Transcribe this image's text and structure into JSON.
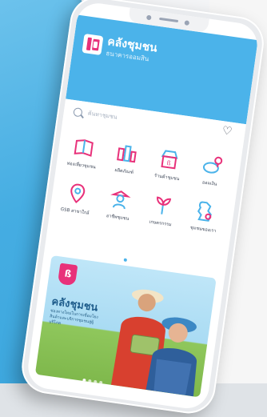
{
  "app": {
    "name": "คลังชุมชน",
    "subtitle": "ธนาคารออมสิน"
  },
  "search": {
    "placeholder": "ค้นหาชุมชน"
  },
  "icons": [
    {
      "name": "book-icon",
      "label": "ท่องเที่ยวชุมชน"
    },
    {
      "name": "products-icon",
      "label": "ผลิตภัณฑ์"
    },
    {
      "name": "shop-icon",
      "label": "ร้านค้าชุมชน"
    },
    {
      "name": "piggy-bank-icon",
      "label": "ออมเงิน"
    },
    {
      "name": "location-pin-icon",
      "label": "GSB สาขาใกล้"
    },
    {
      "name": "farmer-icon",
      "label": "อาชีพชุมชน"
    },
    {
      "name": "plant-icon",
      "label": "เกษตรกรรม"
    },
    {
      "name": "map-icon",
      "label": "ชุมชนของเรา"
    }
  ],
  "banner": {
    "title": "คลังชุมชน",
    "description": "ช่องทางใหม่ในการเชื่อมโยงสินค้าและบริการชุมชนสู่ผู้บริโภค"
  },
  "colors": {
    "brand_blue": "#4bb3ea",
    "brand_pink": "#e8317a"
  }
}
